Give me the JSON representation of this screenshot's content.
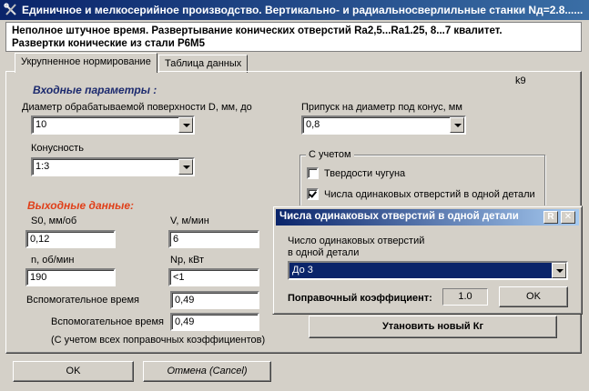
{
  "window": {
    "title": "Единичное и мелкосерийное производство. Вертикально- и радиальносверлильные станки Nд=2.8......"
  },
  "header": {
    "line1": "Неполное штучное время. Развертывание конических отверстий Ra2,5...Ra1.25, 8...7 квалитет.",
    "line2": "Развертки конические из стали Р6М5"
  },
  "tabs": [
    {
      "label": "Укрупненное нормирование",
      "active": true
    },
    {
      "label": "Таблица данных",
      "active": false
    }
  ],
  "panel": {
    "corner_code": "k9",
    "input_section_title": "Входные параметры :",
    "diameter": {
      "label": "Диаметр обрабатываемой поверхности D, мм, до",
      "value": "10"
    },
    "allowance": {
      "label": "Припуск на диаметр под конус, мм",
      "value": "0,8"
    },
    "taper": {
      "label": "Конусность",
      "value": "1:3"
    },
    "considering_group": {
      "title": "С учетом",
      "cast_iron_hardness": {
        "label": "Твердости чугуна",
        "checked": false
      },
      "same_holes": {
        "label": "Числа одинаковых отверстий в одной детали",
        "checked": true
      }
    },
    "output_section_title": "Выходные данные:",
    "s0": {
      "label": "S0, мм/об",
      "value": "0,12"
    },
    "v": {
      "label": "V, м/мин",
      "value": "6"
    },
    "n": {
      "label": "n, об/мин",
      "value": "190"
    },
    "np": {
      "label": "Np, кВт",
      "value": "<1"
    },
    "aux_time_1": {
      "label": "Вспомогательное время",
      "value": "0,49"
    },
    "aux_time_2": {
      "label": "Вспомогательное время",
      "value": "0,49"
    },
    "aux_note": "(С учетом всех поправочных коэффициентов)",
    "set_new_kg_label": "Утановить новый Кг"
  },
  "popup": {
    "title": "Числа одинаковых отверстий в одной детали",
    "restore_glyph": "R",
    "close_glyph": "✕",
    "field_label_line1": "Число одинаковых отверстий",
    "field_label_line2": "в одной детали",
    "field_value": "До 3",
    "coef_label": "Поправочный коэффициент:",
    "coef_value": "1.0",
    "ok_label": "OK"
  },
  "footer": {
    "ok_label": "OK",
    "cancel_label": "Отмена (Cancel)"
  },
  "colors": {
    "section_title_input": "#1c2a6e",
    "section_title_output": "#e0401a",
    "titlebar_start": "#0a246a",
    "titlebar_end": "#3a6ea5",
    "selection": "#0a246a"
  }
}
